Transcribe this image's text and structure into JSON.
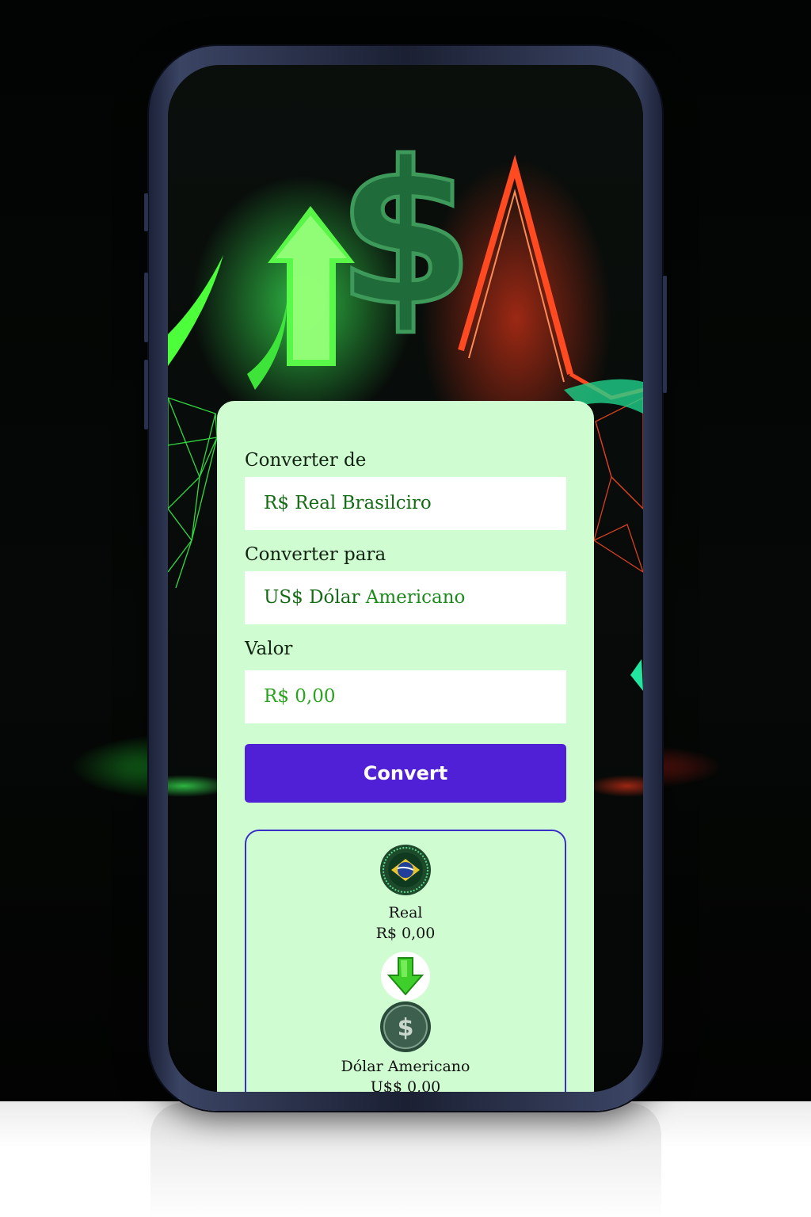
{
  "form": {
    "from_label": "Converter de",
    "from_value": "R$ Real Brasilciro",
    "to_label": "Converter para",
    "to_value_part1": "US$ Dólar ",
    "to_value_part2": "Americano",
    "amount_label": "Valor",
    "amount_value": "R$ 0,00",
    "convert_label": "Convert"
  },
  "result": {
    "from_name": "Real",
    "from_amount": "R$ 0,00",
    "to_name": "Dólar Americano",
    "to_amount": "U$$ 0,00"
  },
  "colors": {
    "card_bg": "#d0fcd2",
    "button_bg": "#5020d6",
    "result_border": "#3a2fc9",
    "field_text": "#146b14"
  },
  "icons": {
    "hero_dollar": "dollar-sign-icon",
    "hero_up_arrow": "arrow-up-icon",
    "brazil_coin": "brazil-flag-coin-icon",
    "down_arrow": "arrow-down-icon",
    "dollar_coin": "dollar-coin-icon"
  }
}
